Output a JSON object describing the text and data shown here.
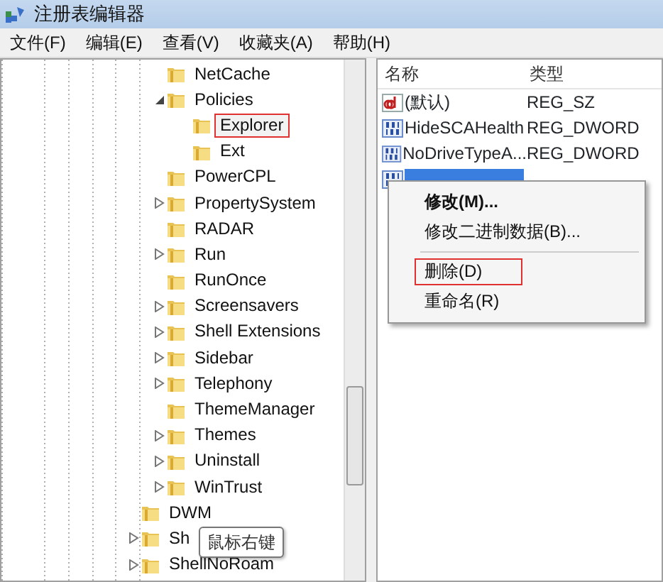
{
  "window": {
    "title": "注册表编辑器"
  },
  "menu": [
    "文件(F)",
    "编辑(E)",
    "查看(V)",
    "收藏夹(A)",
    "帮助(H)"
  ],
  "tree": {
    "items": [
      {
        "children": [
          {
            "label": "NetCache",
            "expandable": false,
            "expanded": false,
            "selected": false
          },
          {
            "label": "Policies",
            "expandable": true,
            "expanded": true,
            "selected": false,
            "children": [
              {
                "label": "Explorer",
                "expandable": false,
                "expanded": false,
                "selected": true
              },
              {
                "label": "Ext",
                "expandable": false,
                "expanded": false,
                "selected": false
              }
            ]
          },
          {
            "label": "PowerCPL",
            "expandable": false,
            "expanded": false,
            "selected": false
          },
          {
            "label": "PropertySystem",
            "expandable": true,
            "expanded": false,
            "selected": false
          },
          {
            "label": "RADAR",
            "expandable": false,
            "expanded": false,
            "selected": false
          },
          {
            "label": "Run",
            "expandable": true,
            "expanded": false,
            "selected": false
          },
          {
            "label": "RunOnce",
            "expandable": false,
            "expanded": false,
            "selected": false
          },
          {
            "label": "Screensavers",
            "expandable": true,
            "expanded": false,
            "selected": false
          },
          {
            "label": "Shell Extensions",
            "expandable": true,
            "expanded": false,
            "selected": false
          },
          {
            "label": "Sidebar",
            "expandable": true,
            "expanded": false,
            "selected": false
          },
          {
            "label": "Telephony",
            "expandable": true,
            "expanded": false,
            "selected": false
          },
          {
            "label": "ThemeManager",
            "expandable": false,
            "expanded": false,
            "selected": false
          },
          {
            "label": "Themes",
            "expandable": true,
            "expanded": false,
            "selected": false
          },
          {
            "label": "Uninstall",
            "expandable": true,
            "expanded": false,
            "selected": false
          },
          {
            "label": "WinTrust",
            "expandable": true,
            "expanded": false,
            "selected": false
          }
        ]
      },
      {
        "label": "DWM",
        "expandable": false,
        "expanded": false,
        "selected": false
      },
      {
        "label": "Sh",
        "expandable": true,
        "expanded": false,
        "selected": false
      },
      {
        "label": "ShellNoRoam",
        "expandable": true,
        "expanded": false,
        "selected": false
      }
    ]
  },
  "values": {
    "columns": [
      "名称",
      "类型"
    ],
    "rows": [
      {
        "kind": "string",
        "name": "(默认)",
        "type": "REG_SZ",
        "selected": false
      },
      {
        "kind": "dword",
        "name": "HideSCAHealth",
        "type": "REG_DWORD",
        "selected": false
      },
      {
        "kind": "dword",
        "name": "NoDriveTypeA...",
        "type": "REG_DWORD",
        "selected": false
      },
      {
        "kind": "dword",
        "selected": true
      }
    ]
  },
  "context_menu": [
    {
      "kind": "item",
      "label": "修改(M)...",
      "default": true,
      "highlighted": false
    },
    {
      "kind": "item",
      "label": "修改二进制数据(B)...",
      "default": false,
      "highlighted": false
    },
    {
      "kind": "separator"
    },
    {
      "kind": "item",
      "label": "删除(D)",
      "default": false,
      "highlighted": true
    },
    {
      "kind": "item",
      "label": "重命名(R)",
      "default": false,
      "highlighted": false
    }
  ],
  "tooltip": "鼠标右键"
}
